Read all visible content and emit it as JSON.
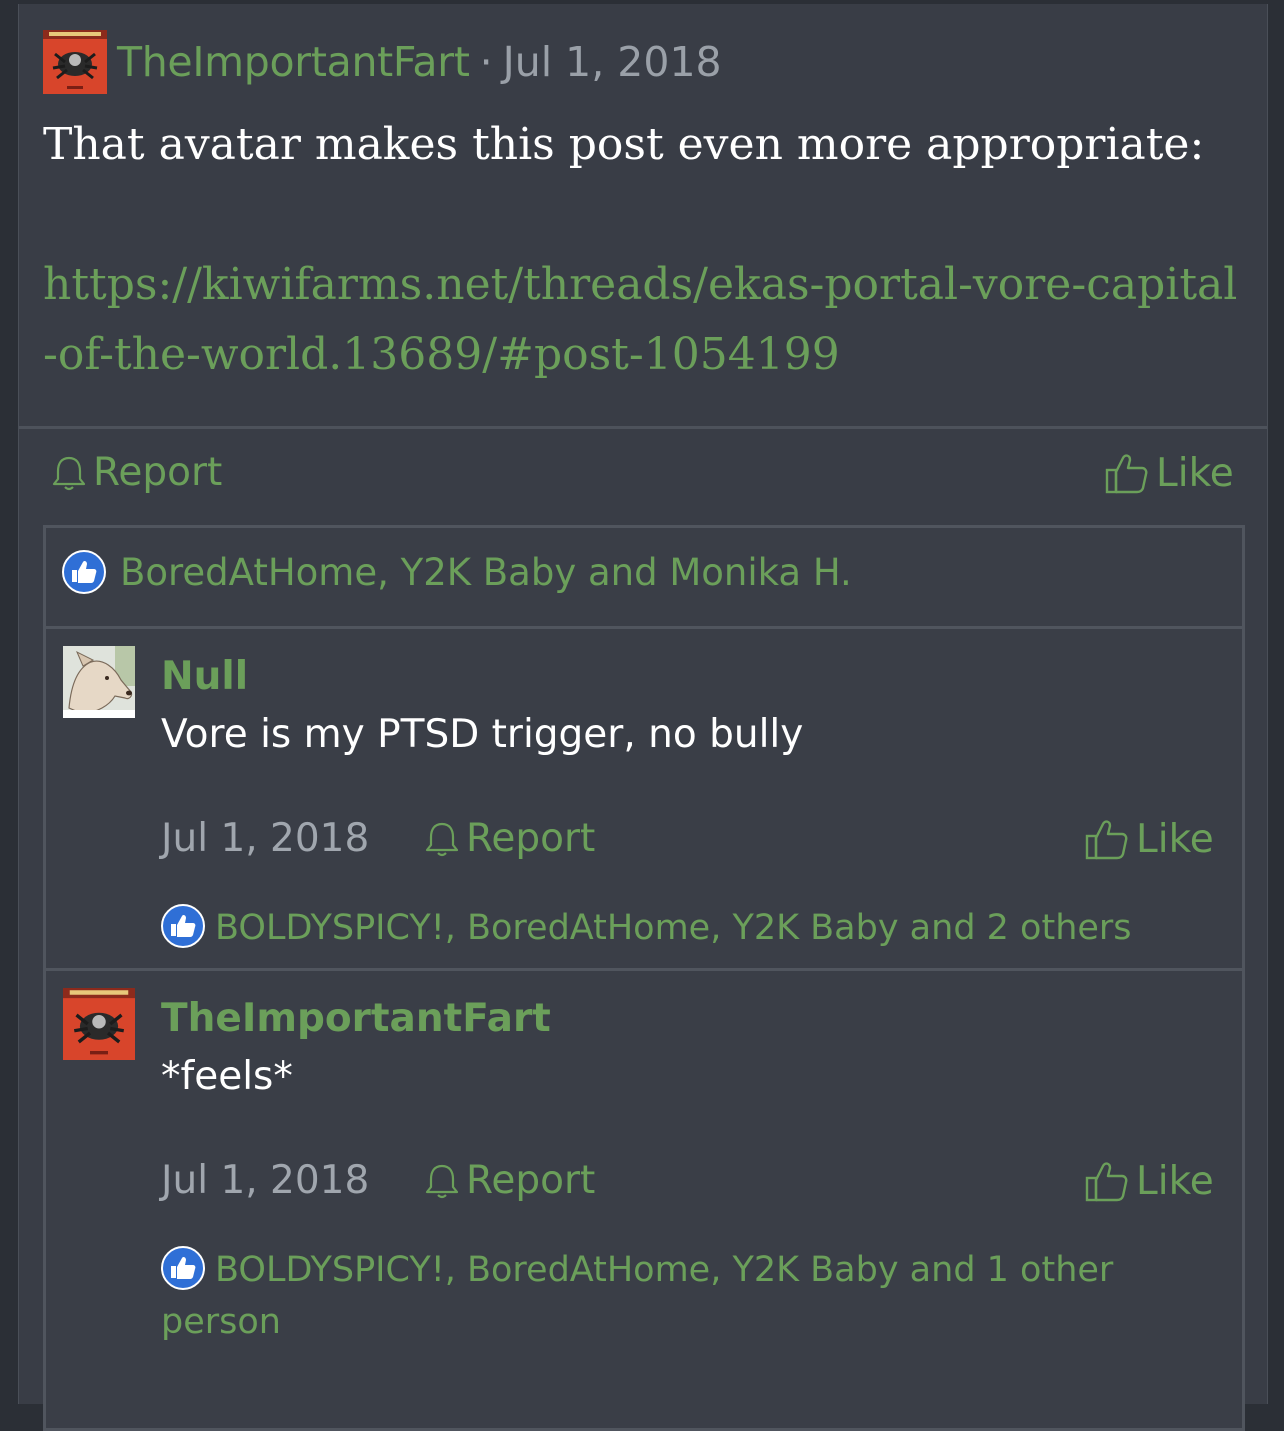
{
  "post": {
    "author": "TheImportantFart",
    "separator": "·",
    "date": "Jul 1, 2018",
    "body": "That avatar makes this post even more appropriate:",
    "link": "https://kiwifarms.net/threads/ekas-portal-vore-capital-of-the-world.13689/#post-1054199",
    "report_label": "Report",
    "like_label": "Like",
    "reactions": "BoredAtHome, Y2K Baby and Monika H."
  },
  "comments": [
    {
      "author": "Null",
      "text": "Vore is my PTSD trigger, no bully",
      "date": "Jul 1, 2018",
      "report_label": "Report",
      "like_label": "Like",
      "reactions": "BOLDYSPICY!, BoredAtHome, Y2K Baby and 2 others"
    },
    {
      "author": "TheImportantFart",
      "text": "*feels*",
      "date": "Jul 1, 2018",
      "report_label": "Report",
      "like_label": "Like",
      "reactions": "BOLDYSPICY!, BoredAtHome, Y2K Baby and 1 other person"
    }
  ],
  "colors": {
    "background": "#2b2f36",
    "panel": "#393d46",
    "accent_green": "#6b9f5a",
    "like_blue": "#2f6fd6"
  },
  "icons": {
    "report": "bell-icon",
    "like": "thumbs-up-icon",
    "reaction": "like-reaction-icon"
  }
}
